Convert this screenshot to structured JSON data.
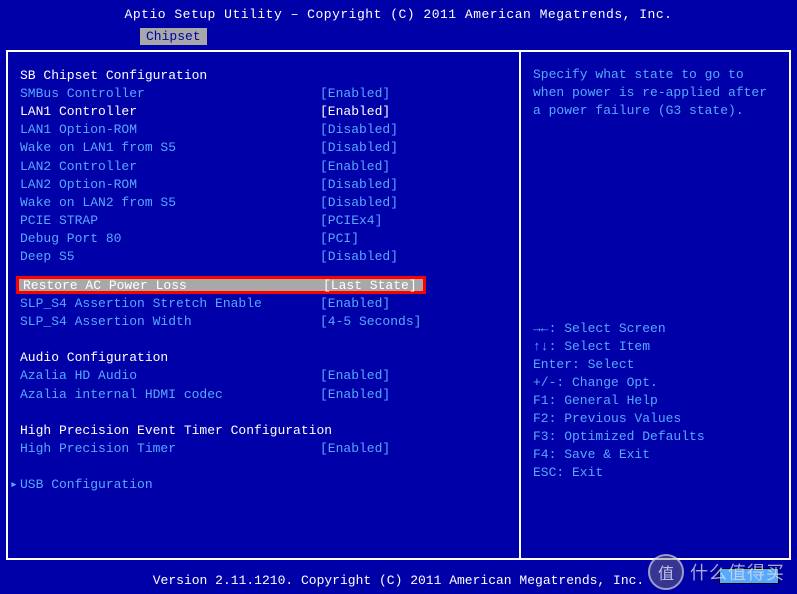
{
  "title": "Aptio Setup Utility – Copyright (C) 2011 American Megatrends, Inc.",
  "tab": "Chipset",
  "left": {
    "section1_header": "SB Chipset Configuration",
    "items1": [
      {
        "label": "SMBus Controller",
        "value": "[Enabled]",
        "white": false
      },
      {
        "label": "LAN1 Controller",
        "value": "[Enabled]",
        "white": true
      },
      {
        "label": "LAN1 Option-ROM",
        "value": "[Disabled]",
        "white": false
      },
      {
        "label": "Wake on LAN1 from S5",
        "value": "[Disabled]",
        "white": false
      },
      {
        "label": "LAN2 Controller",
        "value": "[Enabled]",
        "white": false
      },
      {
        "label": "LAN2 Option-ROM",
        "value": "[Disabled]",
        "white": false
      },
      {
        "label": "Wake on LAN2 from S5",
        "value": "[Disabled]",
        "white": false
      },
      {
        "label": "PCIE STRAP",
        "value": "[PCIEx4]",
        "white": false
      },
      {
        "label": "Debug Port 80",
        "value": "[PCI]",
        "white": false
      },
      {
        "label": "Deep S5",
        "value": "[Disabled]",
        "white": false
      }
    ],
    "selected": {
      "label": "Restore AC Power Loss",
      "value": "[Last State]"
    },
    "items2": [
      {
        "label": "SLP_S4 Assertion Stretch Enable",
        "value": "[Enabled]"
      },
      {
        "label": "SLP_S4 Assertion Width",
        "value": "[4-5 Seconds]"
      }
    ],
    "section2_header": "Audio Configuration",
    "items3": [
      {
        "label": "Azalia HD Audio",
        "value": "[Enabled]"
      },
      {
        "label": "Azalia internal HDMI codec",
        "value": "[Enabled]"
      }
    ],
    "section3_header": "High Precision Event Timer Configuration",
    "items4": [
      {
        "label": "High Precision Timer",
        "value": "[Enabled]"
      }
    ],
    "submenu": "USB Configuration"
  },
  "right": {
    "help": "Specify what state to go to when power is re-applied after a power failure (G3 state).",
    "nav": [
      "→←: Select Screen",
      "↑↓: Select Item",
      "Enter: Select",
      "+/-: Change Opt.",
      "F1: General Help",
      "F2: Previous Values",
      "F3: Optimized Defaults",
      "F4: Save & Exit",
      "ESC: Exit"
    ]
  },
  "footer": "Version 2.11.1210. Copyright (C) 2011 American Megatrends, Inc.",
  "watermark": {
    "icon": "值",
    "text": "什么值得买"
  }
}
